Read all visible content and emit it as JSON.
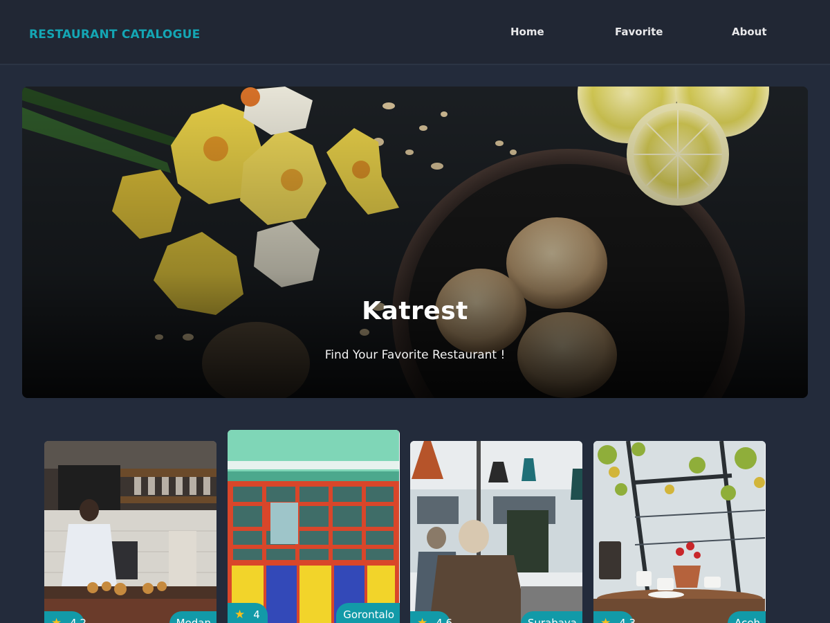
{
  "header": {
    "brand": "RESTAURANT CATALOGUE",
    "nav": [
      {
        "label": "Home"
      },
      {
        "label": "Favorite"
      },
      {
        "label": "About"
      }
    ]
  },
  "hero": {
    "title": "Katrest",
    "subtitle": "Find Your Favorite Restaurant !"
  },
  "restaurants": [
    {
      "rating": "4.2",
      "city": "Medan"
    },
    {
      "rating": "4",
      "city": "Gorontalo"
    },
    {
      "rating": "4.6",
      "city": "Surabaya"
    },
    {
      "rating": "4.3",
      "city": "Aceh"
    }
  ],
  "colors": {
    "background": "#232b3b",
    "navbar": "#212734",
    "brand": "#14a6b4",
    "badge": "#129aa8",
    "star": "#f6c01c"
  },
  "icons": {
    "rating": "star-icon"
  }
}
